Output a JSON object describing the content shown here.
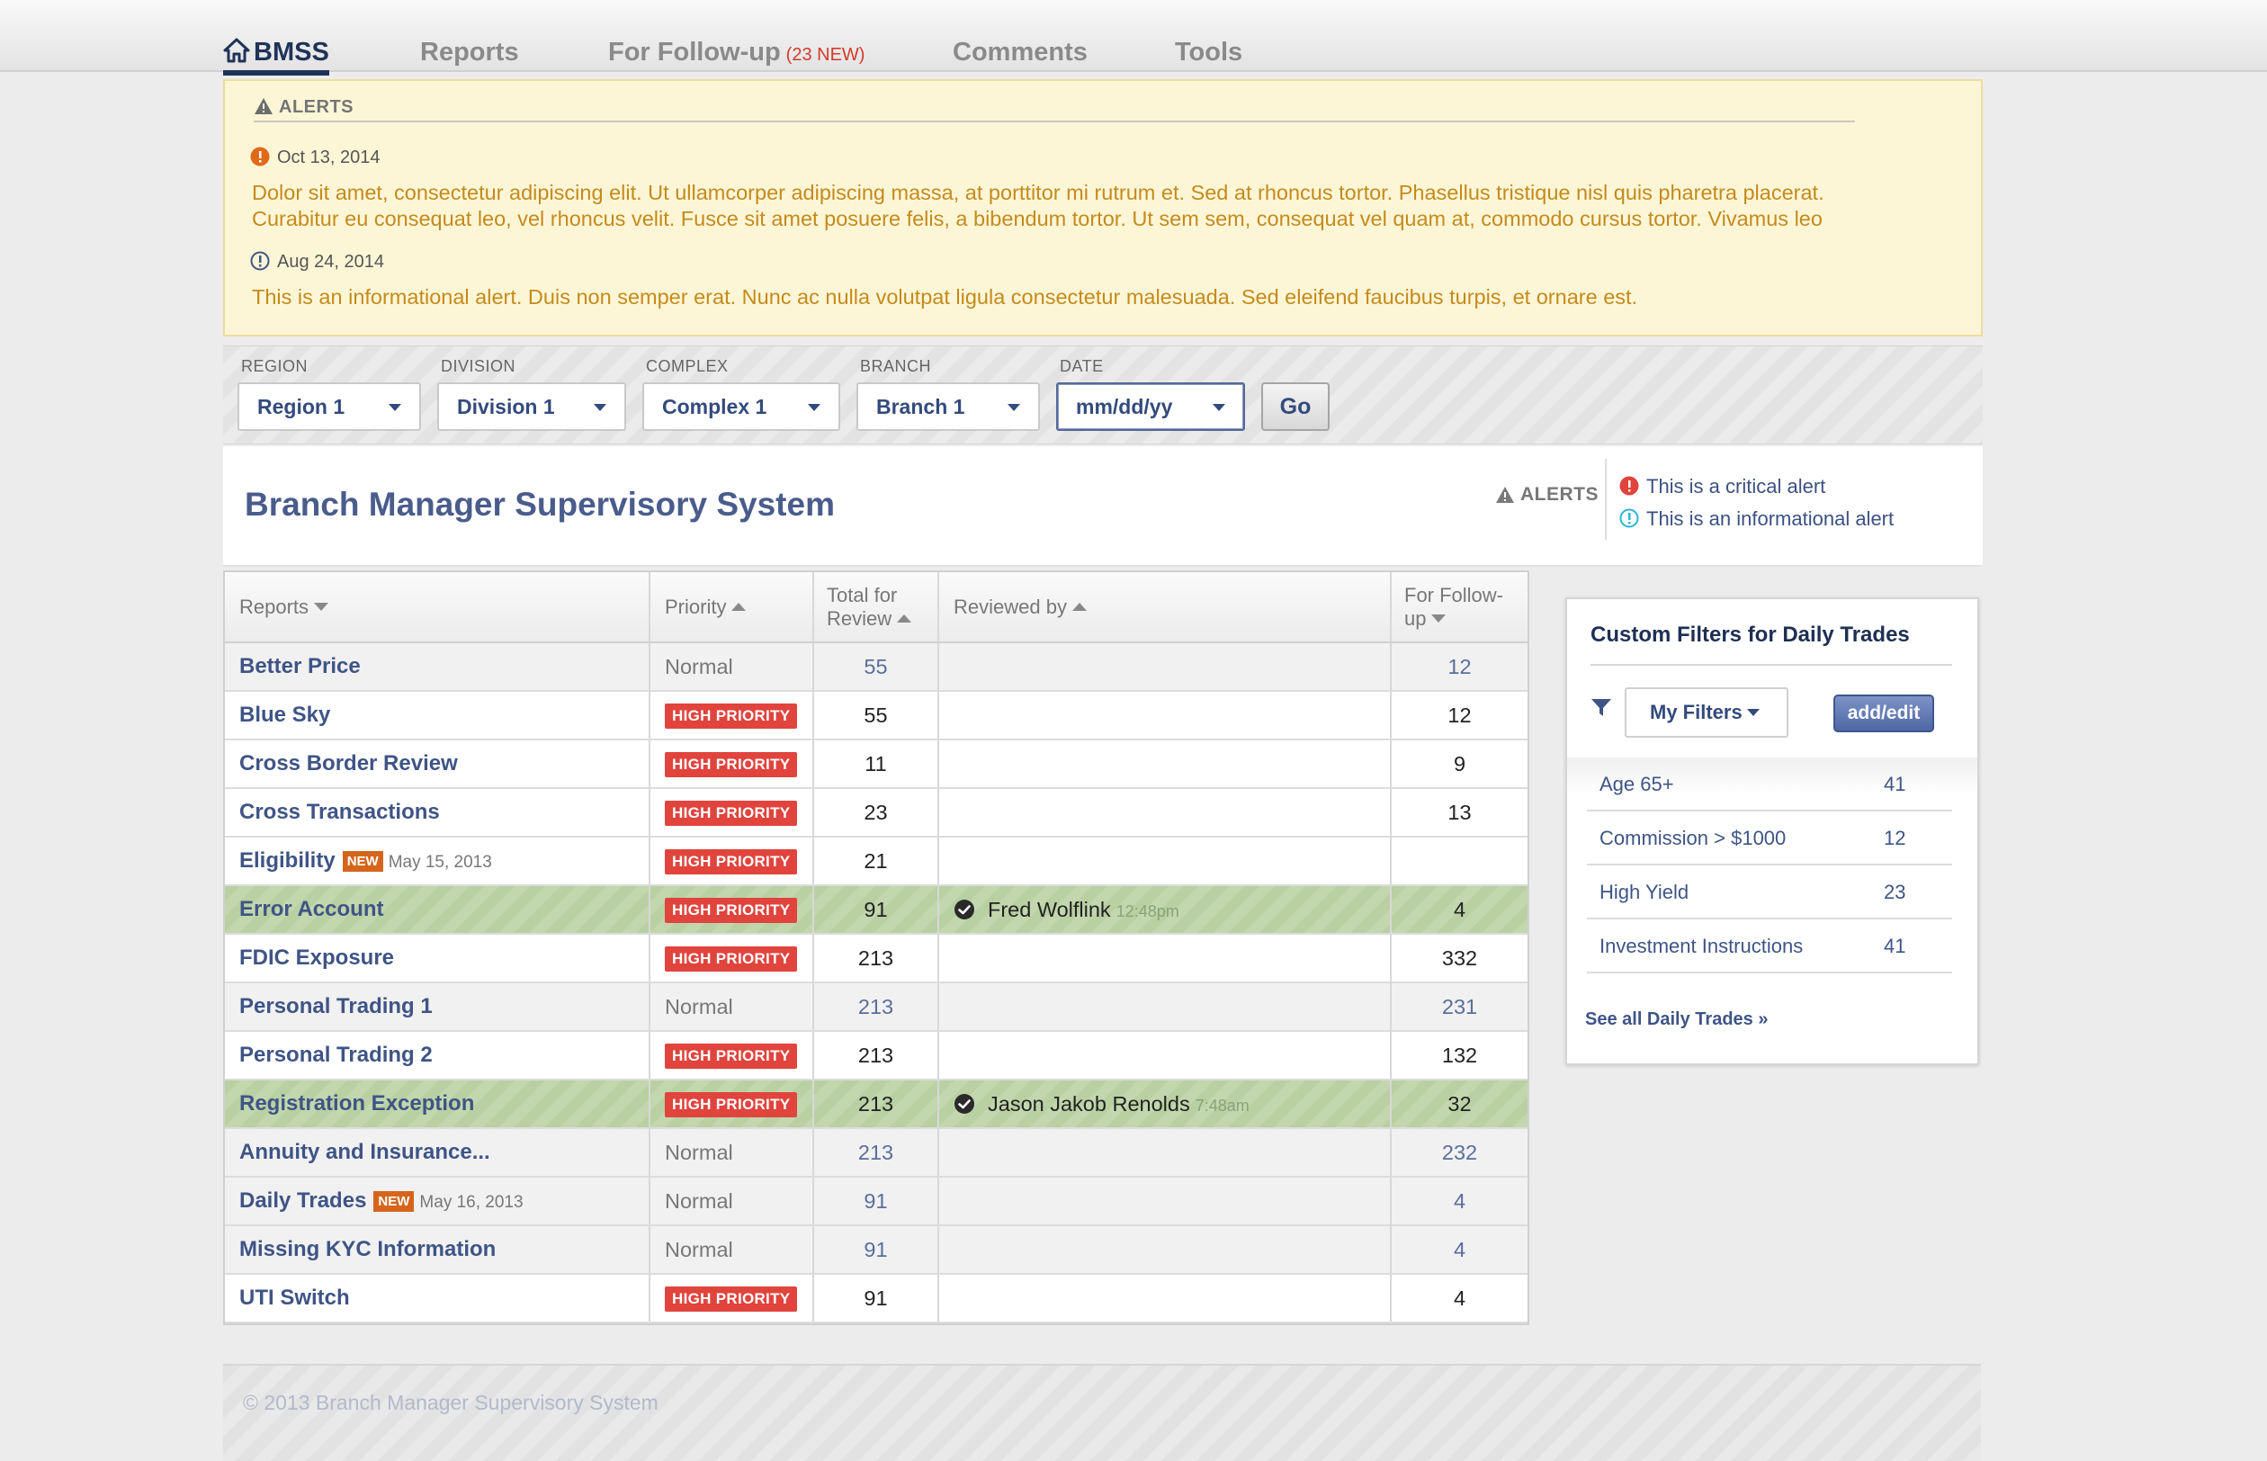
{
  "nav": {
    "items": [
      {
        "label": "BMSS"
      },
      {
        "label": "Reports"
      },
      {
        "label": "For Follow-up",
        "badge": "(23 NEW)"
      },
      {
        "label": "Comments"
      },
      {
        "label": "Tools"
      }
    ],
    "active_color": "#1f3258"
  },
  "alerts": {
    "heading": "ALERTS",
    "items": [
      {
        "date": "Oct 13, 2014",
        "type": "critical",
        "icon": "critical-alert-icon",
        "color": "#e06a1a",
        "lines": [
          "Dolor sit amet, consectetur adipiscing elit. Ut ullamcorper adipiscing massa, at porttitor mi rutrum et. Sed at rhoncus tortor. Phasellus tristique nisl quis pharetra placerat.",
          "Curabitur eu consequat leo, vel rhoncus velit. Fusce sit amet posuere felis, a bibendum tortor. Ut sem sem, consequat vel quam at, commodo cursus tortor. Vivamus leo"
        ]
      },
      {
        "date": "Aug 24, 2014",
        "type": "informational",
        "icon": "info-alert-icon",
        "color": "#3f5486",
        "lines": [
          "This is an informational alert. Duis non semper erat. Nunc ac nulla volutpat ligula consectetur malesuada. Sed eleifend faucibus turpis, et ornare est."
        ]
      }
    ]
  },
  "filters": {
    "region": {
      "label": "REGION",
      "value": "Region 1"
    },
    "division": {
      "label": "DIVISION",
      "value": "Division 1"
    },
    "complex": {
      "label": "COMPLEX",
      "value": "Complex 1"
    },
    "branch": {
      "label": "BRANCH",
      "value": "Branch 1"
    },
    "date": {
      "label": "DATE",
      "value": "mm/dd/yy"
    },
    "go_label": "Go"
  },
  "header": {
    "title": "Branch Manager Supervisory System",
    "legend_label": "ALERTS",
    "critical_text": "This is a critical alert",
    "info_text": "This is an informational alert",
    "critical_color": "#e0443d",
    "info_color": "#2bb5d8"
  },
  "table": {
    "columns": [
      "Reports",
      "Priority",
      "Total for Review",
      "Reviewed by",
      "For Follow-up"
    ],
    "rows": [
      {
        "name": "Better Price",
        "priority": "Normal",
        "total": "55",
        "reviewer": "",
        "time": "",
        "followup": "12",
        "style": "gray"
      },
      {
        "name": "Blue Sky",
        "priority": "HIGH PRIORITY",
        "total": "55",
        "reviewer": "",
        "time": "",
        "followup": "12",
        "style": "white"
      },
      {
        "name": "Cross Border Review",
        "priority": "HIGH PRIORITY",
        "total": "11",
        "reviewer": "",
        "time": "",
        "followup": "9",
        "style": "white"
      },
      {
        "name": "Cross Transactions",
        "priority": "HIGH PRIORITY",
        "total": "23",
        "reviewer": "",
        "time": "",
        "followup": "13",
        "style": "white"
      },
      {
        "name": "Eligibility",
        "new": "NEW",
        "date": "May 15, 2013",
        "priority": "HIGH PRIORITY",
        "total": "21",
        "reviewer": "",
        "time": "",
        "followup": "",
        "style": "white"
      },
      {
        "name": "Error Account",
        "priority": "HIGH PRIORITY",
        "total": "91",
        "reviewer": "Fred Wolflink",
        "time": "12:48pm",
        "followup": "4",
        "style": "green"
      },
      {
        "name": "FDIC Exposure",
        "priority": "HIGH PRIORITY",
        "total": "213",
        "reviewer": "",
        "time": "",
        "followup": "332",
        "style": "white"
      },
      {
        "name": "Personal Trading 1",
        "priority": "Normal",
        "total": "213",
        "reviewer": "",
        "time": "",
        "followup": "231",
        "style": "gray"
      },
      {
        "name": "Personal Trading 2",
        "priority": "HIGH PRIORITY",
        "total": "213",
        "reviewer": "",
        "time": "",
        "followup": "132",
        "style": "white"
      },
      {
        "name": "Registration Exception",
        "priority": "HIGH PRIORITY",
        "total": "213",
        "reviewer": "Jason Jakob Renolds",
        "time": "7:48am",
        "followup": "32",
        "style": "green"
      },
      {
        "name": "Annuity and Insurance...",
        "priority": "Normal",
        "total": "213",
        "reviewer": "",
        "time": "",
        "followup": "232",
        "style": "gray"
      },
      {
        "name": "Daily Trades",
        "new": "NEW",
        "date": "May 16, 2013",
        "priority": "Normal",
        "total": "91",
        "reviewer": "",
        "time": "",
        "followup": "4",
        "style": "gray"
      },
      {
        "name": "Missing KYC Information",
        "priority": "Normal",
        "total": "91",
        "reviewer": "",
        "time": "",
        "followup": "4",
        "style": "gray"
      },
      {
        "name": "UTI Switch",
        "priority": "HIGH PRIORITY",
        "total": "91",
        "reviewer": "",
        "time": "",
        "followup": "4",
        "style": "white"
      }
    ]
  },
  "custom_filters": {
    "title": "Custom Filters for Daily Trades",
    "my_filters_label": "My Filters",
    "add_edit_label": "add/edit",
    "items": [
      {
        "label": "Age 65+",
        "count": "41"
      },
      {
        "label": "Commission > $1000",
        "count": "12"
      },
      {
        "label": "High Yield",
        "count": "23"
      },
      {
        "label": "Investment Instructions",
        "count": "41"
      }
    ],
    "see_all_label": "See all Daily Trades »"
  },
  "footer": {
    "copyright": "© 2013 Branch Manager Supervisory System"
  }
}
